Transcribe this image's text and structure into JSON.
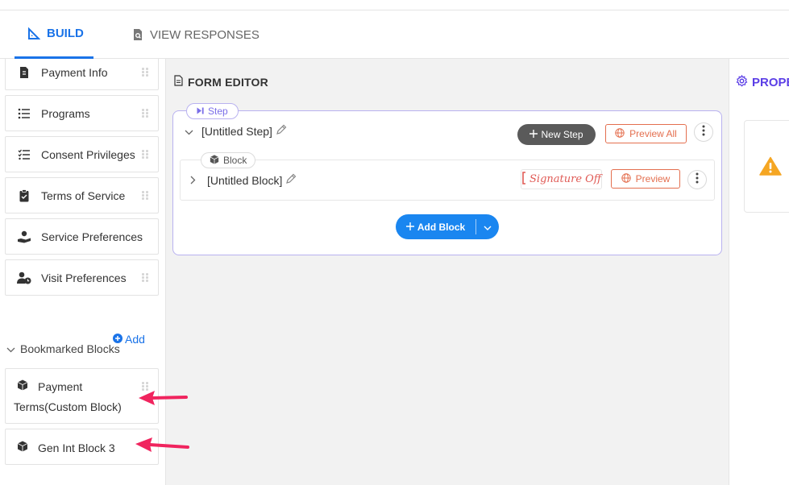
{
  "tabs": {
    "build": "BUILD",
    "view_responses": "VIEW RESPONSES"
  },
  "sidebar": {
    "items": [
      {
        "label": "Payment Info",
        "icon": "document-dollar-icon"
      },
      {
        "label": "Programs",
        "icon": "list-icon"
      },
      {
        "label": "Consent Privileges",
        "icon": "checklist-icon"
      },
      {
        "label": "Terms of Service",
        "icon": "clipboard-icon"
      },
      {
        "label": "Service Preferences",
        "icon": "hand-user-icon"
      },
      {
        "label": "Visit Preferences",
        "icon": "user-clock-icon"
      }
    ],
    "bookmarked_title": "Bookmarked Blocks",
    "add_label": "Add",
    "bookmarked": [
      {
        "line1": "Payment",
        "line2": "Terms(Custom Block)"
      },
      {
        "line1": "Gen Int Block 3"
      }
    ]
  },
  "editor": {
    "title": "FORM EDITOR",
    "step_pill": "Step",
    "step_name": "[Untitled Step]",
    "new_step": "New Step",
    "preview_all": "Preview All",
    "block_pill": "Block",
    "block_name": "[Untitled Block]",
    "signature": "Signature Off",
    "preview": "Preview",
    "add_block": "Add Block"
  },
  "properties": {
    "title": "PROPERTIES"
  },
  "colors": {
    "accent": "#1a73e8",
    "step_border": "#b9b2f0",
    "preview": "#e46f4f",
    "annotation_arrow": "#f0245e"
  }
}
